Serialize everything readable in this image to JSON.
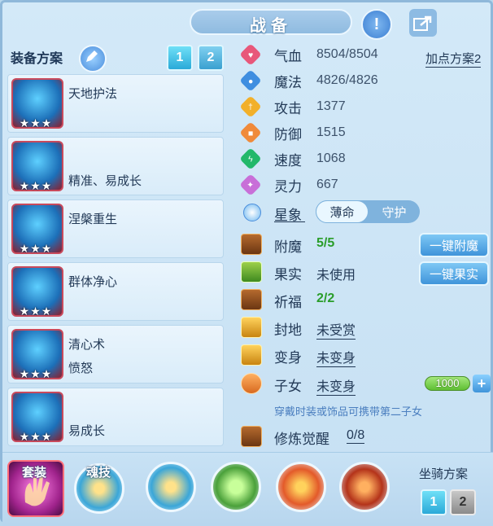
{
  "header": {
    "title": "战备"
  },
  "plans": {
    "label": "装备方案",
    "page_buttons": [
      "1",
      "2"
    ],
    "cards": [
      {
        "line1": "天地护法",
        "line2": "",
        "stars": "★★★"
      },
      {
        "line1": "",
        "line2": "精准、易成长",
        "stars": "★★★"
      },
      {
        "line1": "涅槃重生",
        "line2": "",
        "stars": "★★★"
      },
      {
        "line1": "群体净心",
        "line2": "",
        "stars": "★★★"
      },
      {
        "line1": "清心术",
        "line2": "愤怒",
        "stars": "★★★"
      },
      {
        "line1": "",
        "line2": "易成长",
        "stars": "★★★"
      }
    ]
  },
  "stats": {
    "add_point_plan": "加点方案2",
    "rows": [
      {
        "name": "气血",
        "value": "8504/8504",
        "color": "#e8577a",
        "icon": "heart-icon"
      },
      {
        "name": "魔法",
        "value": "4826/4826",
        "color": "#3f8ee0",
        "icon": "mana-icon"
      },
      {
        "name": "攻击",
        "value": "1377",
        "color": "#f2b02a",
        "icon": "sword-icon"
      },
      {
        "name": "防御",
        "value": "1515",
        "color": "#f08a3a",
        "icon": "shield-icon"
      },
      {
        "name": "速度",
        "value": "1068",
        "color": "#22b86a",
        "icon": "lightning-icon"
      },
      {
        "name": "灵力",
        "value": "667",
        "color": "#c86fd8",
        "icon": "spirit-icon"
      }
    ]
  },
  "star": {
    "label": "星象",
    "tabs": [
      "薄命",
      "守护"
    ]
  },
  "extras": {
    "enchant": {
      "label": "附魔",
      "value": "5/5",
      "button": "一键附魔"
    },
    "fruit": {
      "label": "果实",
      "value": "未使用",
      "button": "一键果实"
    },
    "bless": {
      "label": "祈福",
      "value": "2/2"
    },
    "seal": {
      "label": "封地",
      "value": "未受赏"
    },
    "transform": {
      "label": "变身",
      "value": "未变身"
    },
    "children": {
      "label": "子女",
      "value": "未变身",
      "meter": "1000",
      "plus": "+"
    },
    "note": "穿戴时装或饰品可携带第二子女",
    "cultivation": {
      "label": "修炼觉醒",
      "value": "0/8"
    }
  },
  "bottom": {
    "suit_label": "套装",
    "soul_label": "魂技",
    "mount_label": "坐骑方案",
    "mount_buttons": [
      "1",
      "2"
    ]
  }
}
